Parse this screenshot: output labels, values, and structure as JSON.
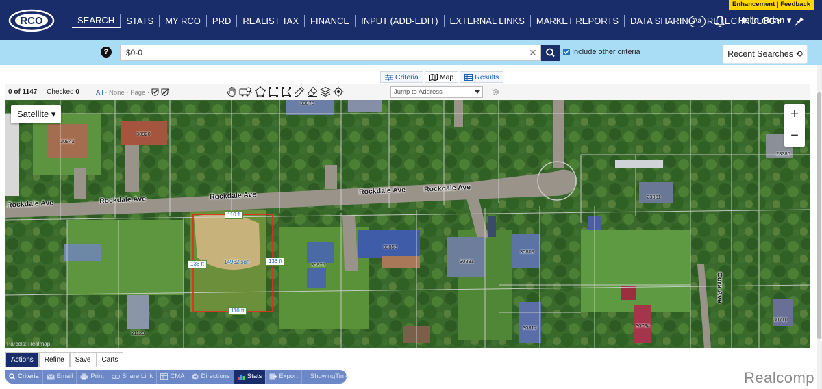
{
  "header": {
    "logo_text": "RCO",
    "nav": [
      "SEARCH",
      "STATS",
      "MY RCO",
      "PRD",
      "REALIST TAX",
      "FINANCE",
      "INPUT (ADD-EDIT)",
      "EXTERNAL LINKS",
      "MARKET REPORTS",
      "DATA SHARING",
      "RETECHNOLOGY"
    ],
    "font_size_btn": "Aa",
    "greeting": "Hello, Brian ▾",
    "enhancement": "Enhancement | Feedback"
  },
  "search": {
    "help": "?",
    "value": "$0-0",
    "clear": "✕",
    "include_other": "Include other criteria",
    "recent": "Recent Searches ⟲"
  },
  "view_tabs": [
    "Criteria",
    "Map",
    "Results"
  ],
  "toolbar": {
    "count": "0 of 1147",
    "checked_label": "Checked",
    "checked_count": "0",
    "select_all": "All",
    "select_none": "None",
    "select_page": "Page",
    "jump_placeholder": "Jump to Address"
  },
  "map": {
    "map_type": "Satellite ▾",
    "zoom_in": "+",
    "zoom_out": "−",
    "road_labels": [
      "Rockdale Ave",
      "Rockdale Ave",
      "Rockdale Ave",
      "Rockdale Ave",
      "Rockdale Ave",
      "Cora Ave"
    ],
    "dims": {
      "top": "110 ft",
      "bottom": "110 ft",
      "left": "136 ft",
      "right": "136 ft",
      "area": "14962 sqft"
    },
    "parcels": [
      "30942",
      "30920",
      "30876",
      "23380",
      "23361",
      "30853",
      "30875",
      "30831",
      "30809",
      "31120",
      "30812",
      "30734",
      "30710"
    ],
    "attribution": "Parcels: Realmap"
  },
  "bottom": {
    "tabs": [
      "Actions",
      "Refine",
      "Save",
      "Carts"
    ],
    "actions": [
      "Criteria",
      "Email",
      "Print",
      "Share Link",
      "CMA",
      "Directions",
      "Stats",
      "Export",
      "ShowingTime"
    ]
  },
  "brand": "Realcomp"
}
